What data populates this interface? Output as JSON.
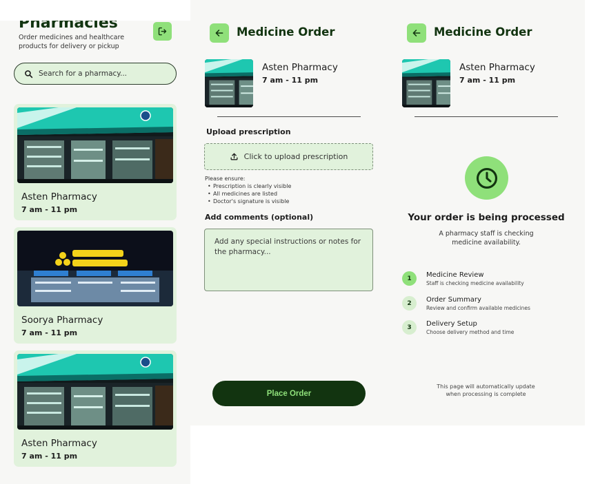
{
  "colors": {
    "brand_dark": "#123410",
    "accent_green": "#8fe07a",
    "card_bg": "#e1f2dc",
    "panel_bg": "#f7f7f5"
  },
  "list_screen": {
    "title": "Pharmacies",
    "subtitle": "Order medicines and healthcare products for delivery or pickup",
    "logout_icon": "logout-icon",
    "search": {
      "placeholder": "Search for a pharmacy...",
      "icon": "search-icon"
    },
    "pharmacies": [
      {
        "name": "Asten Pharmacy",
        "hours": "7 am - 11 pm"
      },
      {
        "name": "Soorya Pharmacy",
        "hours": "7 am - 11 pm"
      },
      {
        "name": "Asten Pharmacy",
        "hours": "7 am - 11 pm"
      }
    ]
  },
  "order_screen": {
    "title": "Medicine Order",
    "back_icon": "arrow-left-icon",
    "pharmacy": {
      "name": "Asten Pharmacy",
      "hours": "7 am - 11 pm"
    },
    "upload_label": "Upload prescription",
    "upload_button": "Click to upload prescription",
    "upload_icon": "upload-icon",
    "ensure_title": "Please ensure:",
    "ensure_items": [
      "Prescription is clearly visible",
      "All medicines are listed",
      "Doctor's signature is visible"
    ],
    "comments_label": "Add comments (optional)",
    "comments_placeholder": "Add any special instructions or notes for the pharmacy...",
    "place_order": "Place Order"
  },
  "processing_screen": {
    "title": "Medicine Order",
    "back_icon": "arrow-left-icon",
    "pharmacy": {
      "name": "Asten Pharmacy",
      "hours": "7 am - 11 pm"
    },
    "status_icon": "clock-icon",
    "status_title": "Your order is being processed",
    "status_subtitle": "A pharmacy staff is checking medicine availability.",
    "steps": [
      {
        "number": "1",
        "title": "Medicine Review",
        "desc": "Staff is checking medicine availability"
      },
      {
        "number": "2",
        "title": "Order Summary",
        "desc": "Review and confirm available medicines"
      },
      {
        "number": "3",
        "title": "Delivery Setup",
        "desc": "Choose delivery method and time"
      }
    ],
    "auto_update_note": "This page will automatically update when processing is complete"
  }
}
